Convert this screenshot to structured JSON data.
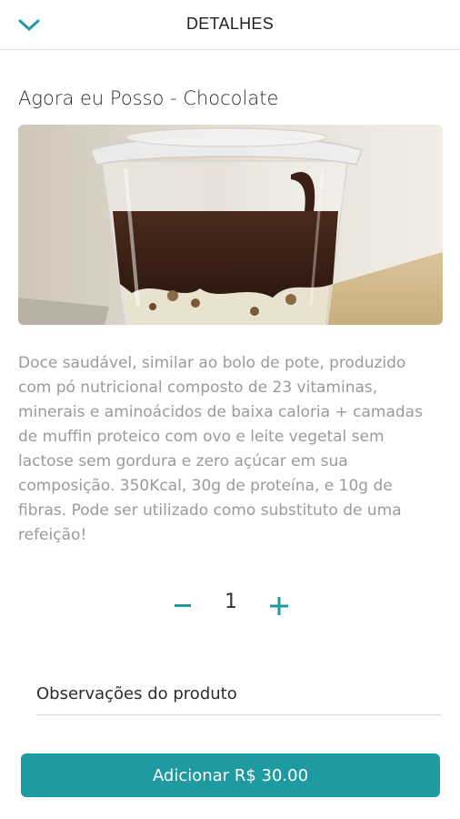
{
  "header": {
    "title": "DETALHES",
    "back_icon": "chevron-down-icon"
  },
  "product": {
    "name": "Agora eu Posso - Chocolate",
    "description": "Doce saudável, similar ao bolo de pote, produzido com pó nutricional composto de 23 vitaminas, minerais e aminoácidos de baixa caloria + camadas de muffin proteico com ovo e leite vegetal sem lactose sem gordura e zero açúcar em sua composição. 350Kcal, 30g de proteína, e 10g de fibras. Pode ser utilizado como substituto de uma refeição!"
  },
  "quantity": {
    "value": "1",
    "minus_icon": "minus-icon",
    "plus_icon": "plus-icon"
  },
  "notes": {
    "placeholder": "Observações do produto"
  },
  "cta": {
    "label": "Adicionar R$ 30.00"
  },
  "colors": {
    "accent": "#1e9aa0",
    "description_text": "#9a9a9a"
  }
}
